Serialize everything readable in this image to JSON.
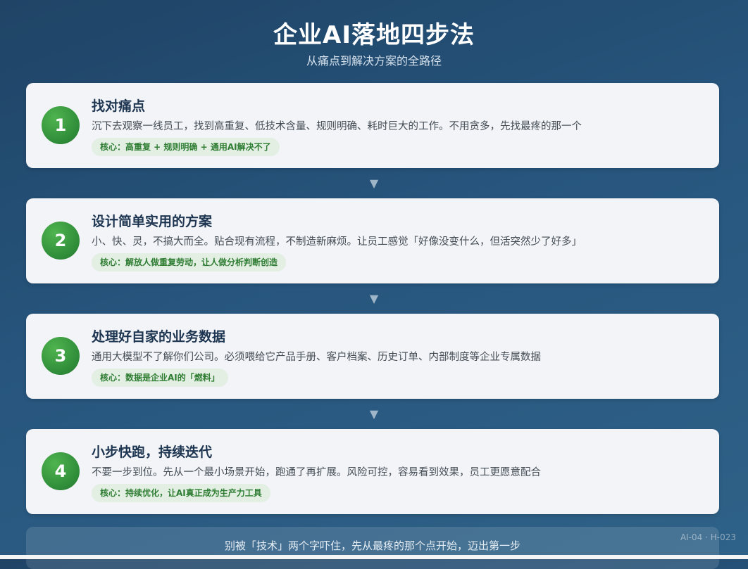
{
  "header": {
    "title": "企业AI落地四步法",
    "subtitle": "从痛点到解决方案的全路径"
  },
  "steps": [
    {
      "number": "1",
      "title": "找对痛点",
      "description": "沉下去观察一线员工，找到高重复、低技术含量、规则明确、耗时巨大的工作。不用贪多，先找最疼的那一个",
      "tag": "核心：高重复 + 规则明确 + 通用AI解决不了"
    },
    {
      "number": "2",
      "title": "设计简单实用的方案",
      "description": "小、快、灵，不搞大而全。贴合现有流程，不制造新麻烦。让员工感觉「好像没变什么，但活突然少了好多」",
      "tag": "核心：解放人做重复劳动，让人做分析判断创造"
    },
    {
      "number": "3",
      "title": "处理好自家的业务数据",
      "description": "通用大模型不了解你们公司。必须喂给它产品手册、客户档案、历史订单、内部制度等企业专属数据",
      "tag": "核心：数据是企业AI的「燃料」"
    },
    {
      "number": "4",
      "title": "小步快跑，持续迭代",
      "description": "不要一步到位。先从一个最小场景开始，跑通了再扩展。风险可控，容易看到效果，员工更愿意配合",
      "tag": "核心：持续优化，让AI真正成为生产力工具"
    }
  ],
  "arrow_glyph": "▼",
  "footer": {
    "text": "别被「技术」两个字吓住，先从最疼的那个点开始，迈出第一步"
  },
  "watermark": "AI-04 · H-023",
  "colors": {
    "background": "#27557d",
    "card": "#f2f4f7",
    "badge": "#2e8b38",
    "tag_bg": "#e3efe3",
    "tag_text": "#2e7d32"
  }
}
